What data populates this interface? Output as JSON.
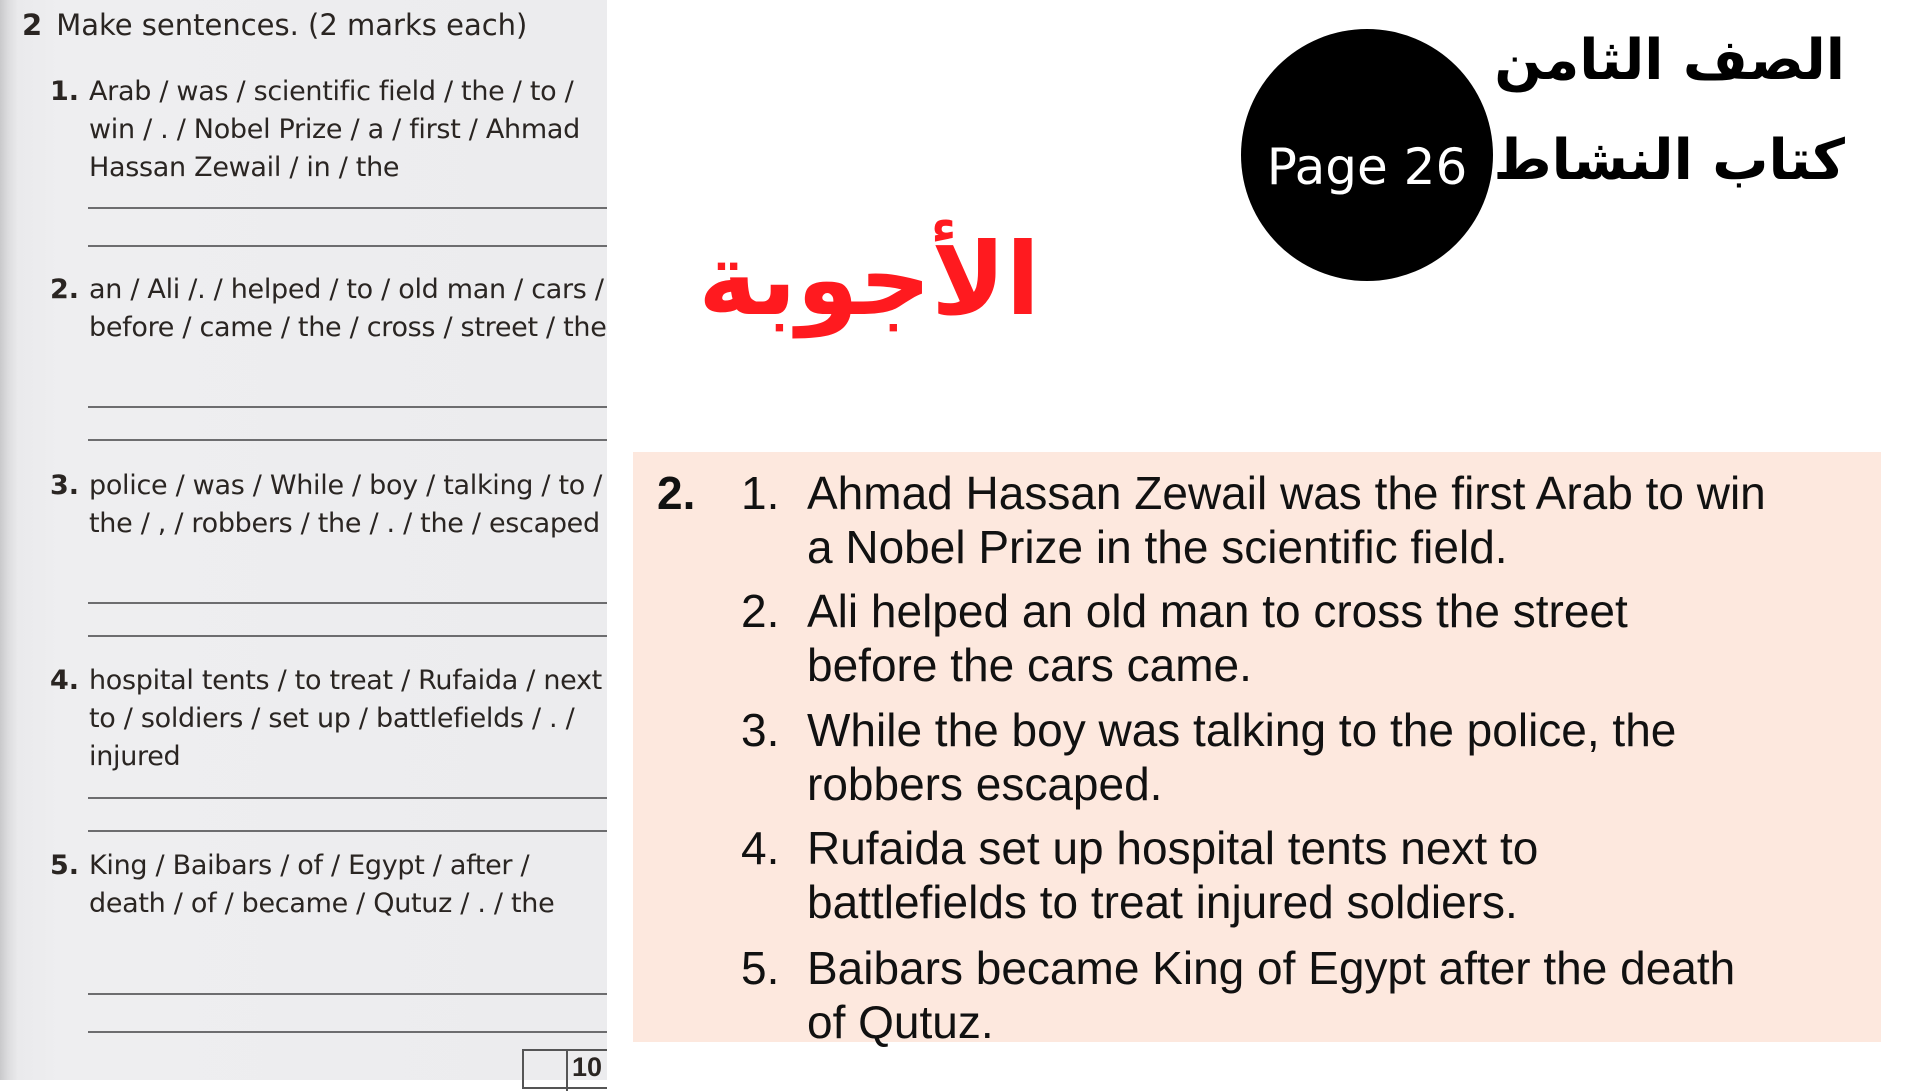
{
  "worksheet": {
    "exercise_number": "2",
    "instruction": "Make sentences. (2 marks each)",
    "items": [
      {
        "number": "1.",
        "prompt": "Arab / was / scientific field / the / to / win / . / Nobel Prize / a / first / Ahmad Hassan Zewail / in / the"
      },
      {
        "number": "2.",
        "prompt": "an / Ali /. / helped / to / old man / cars / before / came / the / cross / street / the"
      },
      {
        "number": "3.",
        "prompt": "police / was / While / boy / talking / to / the / , / robbers / the / . / the / escaped"
      },
      {
        "number": "4.",
        "prompt": "hospital tents / to treat / Rufaida / next to / soldiers / set up / battlefields / . / injured"
      },
      {
        "number": "5.",
        "prompt": "King / Baibars / of / Egypt / after / death / of / became / Qutuz / . / the"
      }
    ],
    "score_total": "10"
  },
  "header": {
    "page_label": "Page 26",
    "grade": "الصف الثامن",
    "book": "كتاب النشاط",
    "answers_title": "الأجوبة"
  },
  "answers": {
    "question_number": "2.",
    "items": [
      {
        "number": "1.",
        "line1": "Ahmad Hassan Zewail was the first Arab to win",
        "line2": "a Nobel Prize in the scientific field."
      },
      {
        "number": "2.",
        "line1": "Ali helped an old man to cross the street",
        "line2": "before the cars came."
      },
      {
        "number": "3.",
        "line1": "While the boy was talking to the police, the",
        "line2": "robbers escaped."
      },
      {
        "number": "4.",
        "line1": "Rufaida set up hospital tents next to",
        "line2": "battlefields to treat injured soldiers."
      },
      {
        "number": "5.",
        "line1": "Baibars became King of Egypt after the death",
        "line2": "of Qutuz."
      }
    ]
  },
  "colors": {
    "answers_title": "#ff1a1f",
    "answer_box_bg": "#fde8de",
    "badge_bg": "#000000"
  }
}
